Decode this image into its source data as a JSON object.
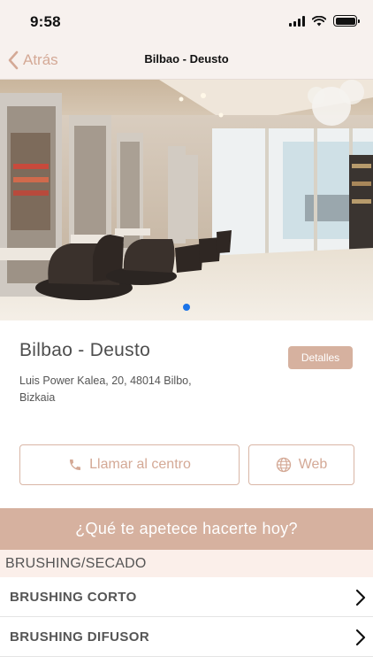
{
  "status_bar": {
    "time": "9:58"
  },
  "nav": {
    "back_label": "Atrás",
    "title": "Bilbao - Deusto"
  },
  "hero": {
    "image_description_icon": "salon-interior-photo",
    "carousel_pages": 1,
    "active_page": 1
  },
  "salon": {
    "name": "Bilbao - Deusto",
    "details_label": "Detalles",
    "address": "Luis Power Kalea, 20, 48014 Bilbo, Bizkaia"
  },
  "actions": {
    "call_label": "Llamar al centro",
    "call_icon": "phone-icon",
    "web_label": "Web",
    "web_icon": "globe-icon"
  },
  "banner": {
    "question": "¿Qué te apetece hacerte hoy?"
  },
  "services": {
    "category": "BRUSHING/SECADO",
    "items": [
      {
        "label": "BRUSHING CORTO"
      },
      {
        "label": "BRUSHING DIFUSOR"
      }
    ]
  },
  "colors": {
    "accent": "#d4a996",
    "banner": "#d6b19f",
    "nav_bg": "#f7f1ee",
    "category_bg": "#fbefea",
    "dot": "#1a73e8"
  }
}
